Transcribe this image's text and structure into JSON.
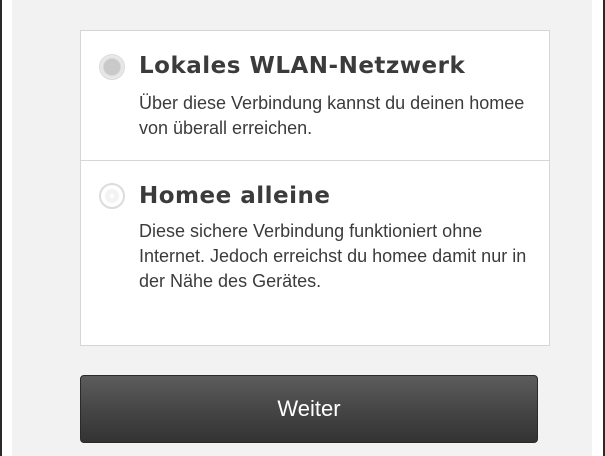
{
  "options": [
    {
      "title": "Lokales WLAN-Netzwerk",
      "description": "Über diese Verbindung kannst du deinen homee von überall erreichen.",
      "selected": true
    },
    {
      "title": "Homee alleine",
      "description": "Diese sichere Verbindung funktioniert ohne Internet. Jedoch erreichst du homee damit nur in der Nähe des Gerätes.",
      "selected": false
    }
  ],
  "next_button": {
    "label": "Weiter"
  }
}
